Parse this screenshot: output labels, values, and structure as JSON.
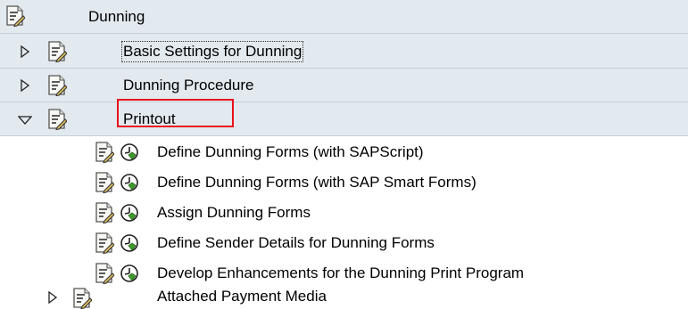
{
  "tree": {
    "root": {
      "label": "Dunning",
      "icon": "sap-activity-document-icon"
    },
    "nodes": [
      {
        "label": "Basic Settings for Dunning",
        "expander": "collapsed",
        "icon": "sap-activity-document-icon",
        "focused": true
      },
      {
        "label": "Dunning Procedure",
        "expander": "collapsed",
        "icon": "sap-activity-document-icon"
      },
      {
        "label": "Printout",
        "expander": "expanded",
        "icon": "sap-activity-document-icon",
        "highlighted": true,
        "children": [
          {
            "label": "Define Dunning Forms (with SAPScript)",
            "icons": [
              "sap-activity-document-icon",
              "execute-clock-icon"
            ]
          },
          {
            "label": "Define Dunning Forms (with SAP Smart Forms)",
            "icons": [
              "sap-activity-document-icon",
              "execute-clock-icon"
            ]
          },
          {
            "label": "Assign Dunning Forms",
            "icons": [
              "sap-activity-document-icon",
              "execute-clock-icon"
            ]
          },
          {
            "label": "Define Sender Details for Dunning Forms",
            "icons": [
              "sap-activity-document-icon",
              "execute-clock-icon"
            ]
          },
          {
            "label": "Develop Enhancements for the Dunning Print Program",
            "icons": [
              "sap-activity-document-icon",
              "execute-clock-icon"
            ]
          }
        ]
      },
      {
        "label": "Attached Payment Media",
        "expander": "collapsed",
        "icon": "sap-activity-document-icon"
      }
    ]
  },
  "colors": {
    "shaded_row": "#e2e9ef",
    "highlight_box": "#e8141c",
    "clock_green": "#3d9b2a"
  }
}
